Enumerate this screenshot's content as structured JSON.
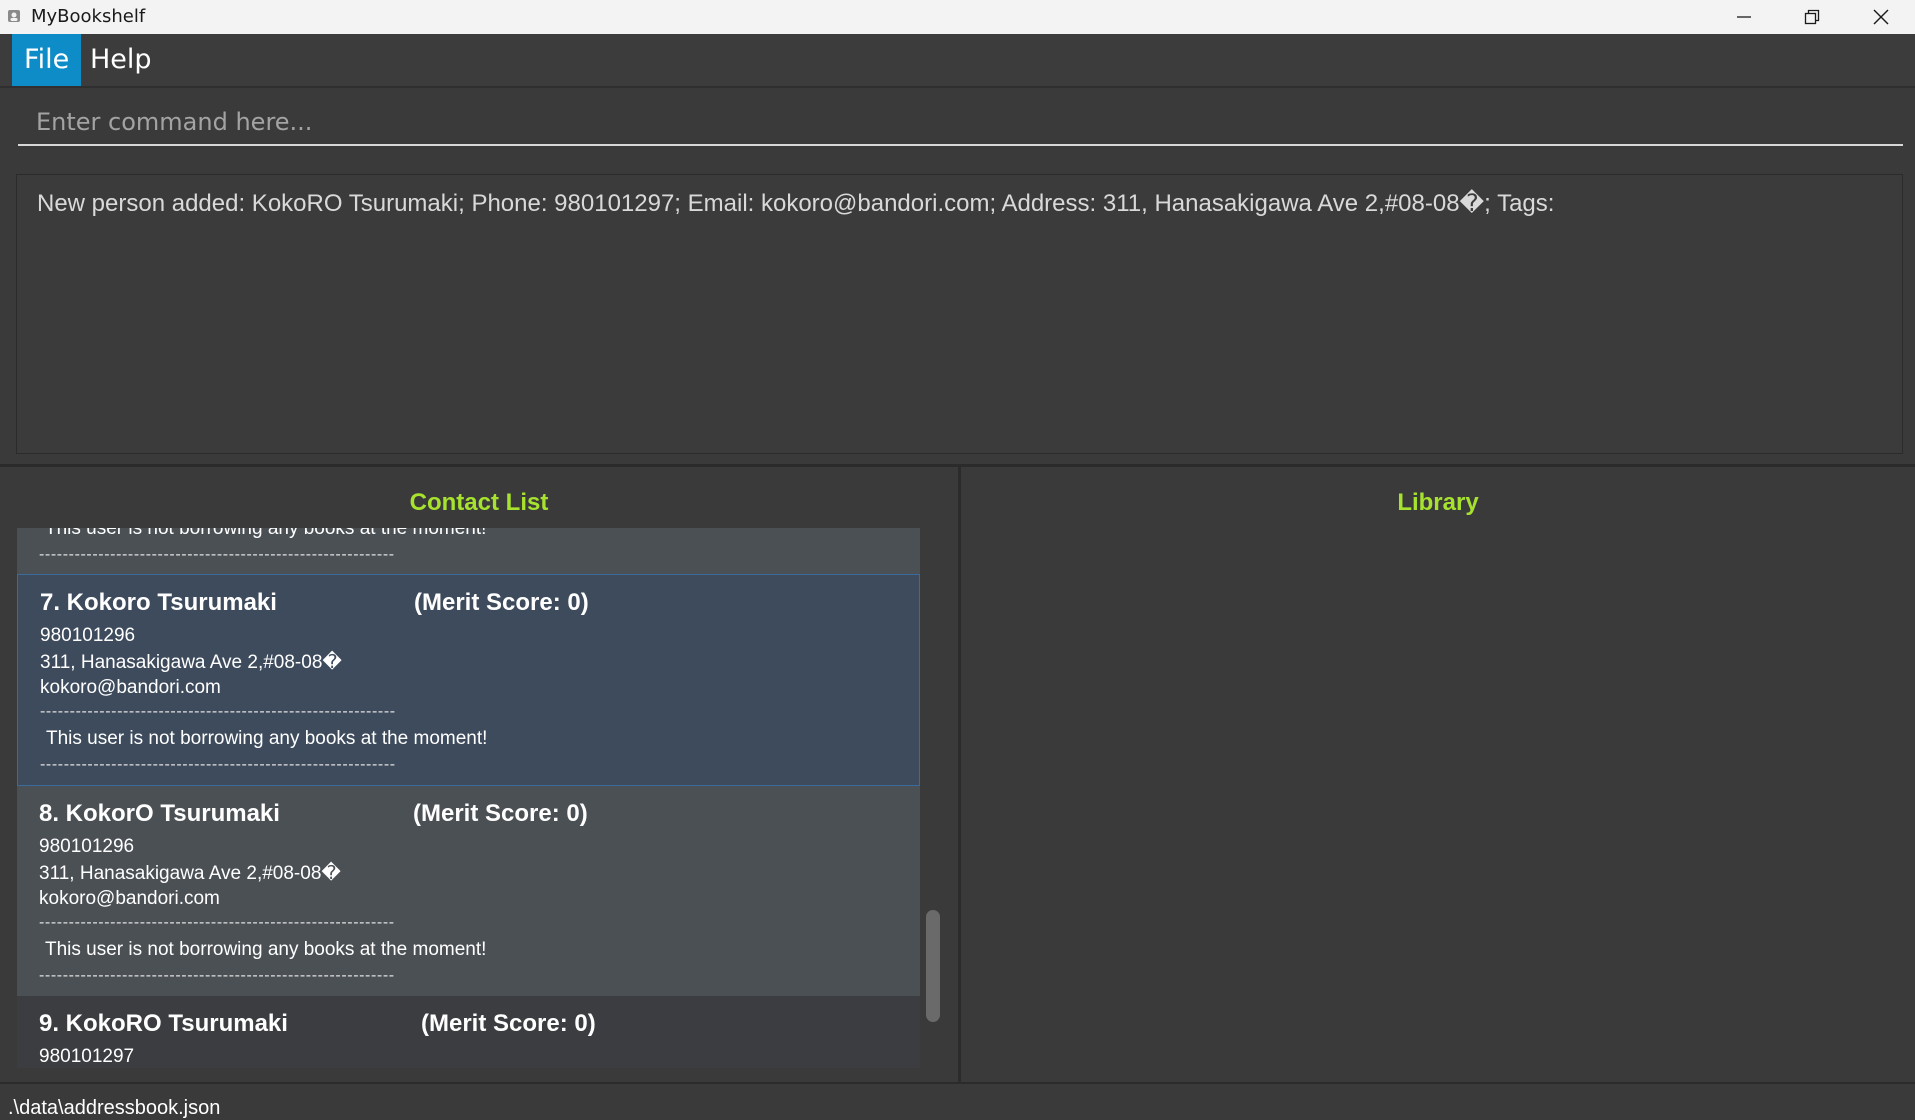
{
  "window": {
    "title": "MyBookshelf",
    "controls": [
      "minimize-icon",
      "maximize-icon",
      "close-icon"
    ]
  },
  "menu": {
    "file_label": "File",
    "help_label": "Help"
  },
  "command": {
    "placeholder": "Enter command here...",
    "value": ""
  },
  "result": {
    "text": "New person added: KokoRO Tsurumaki; Phone: 980101297; Email: kokoro@bandori.com; Address: 311, Hanasakigawa Ave 2,#08-08�; Tags:"
  },
  "contact_list": {
    "title": "Contact List",
    "dashes": "------------------------------------------------------------",
    "partial_status": "This user is not borrowing any books at the moment!",
    "cards": [
      {
        "index_name": "7.  Kokoro Tsurumaki",
        "merit": "(Merit Score: 0)",
        "phone": "980101296",
        "address": "311, Hanasakigawa Ave 2,#08-08�",
        "email": "kokoro@bandori.com",
        "status": "This user is not borrowing any books at the moment!"
      },
      {
        "index_name": "8.  KokorO Tsurumaki",
        "merit": "(Merit Score: 0)",
        "phone": "980101296",
        "address": "311, Hanasakigawa Ave 2,#08-08�",
        "email": "kokoro@bandori.com",
        "status": "This user is not borrowing any books at the moment!"
      },
      {
        "index_name": "9.  KokoRO Tsurumaki",
        "merit": "(Merit Score: 0)",
        "phone": "980101297"
      }
    ]
  },
  "library": {
    "title": "Library"
  },
  "status_bar": {
    "path": ".\\data\\addressbook.json"
  }
}
